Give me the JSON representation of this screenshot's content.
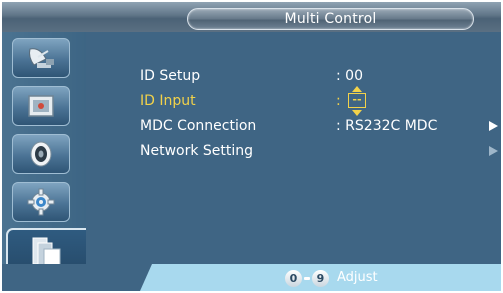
{
  "window": {
    "title": "Multi Control"
  },
  "sidebar": {
    "items": [
      {
        "icon": "satellite-dish-icon"
      },
      {
        "icon": "picture-frame-icon"
      },
      {
        "icon": "speaker-icon"
      },
      {
        "icon": "settings-gear-icon"
      },
      {
        "icon": "multi-display-icon",
        "active": true
      }
    ]
  },
  "menu": {
    "rows": [
      {
        "label": "ID Setup",
        "value": ": 00"
      },
      {
        "label": "ID Input",
        "value_prefix": ":",
        "value_box": "--",
        "selected": true
      },
      {
        "label": "MDC Connection",
        "value": ": RS232C MDC",
        "arrow": true
      },
      {
        "label": "Network Setting",
        "arrow": true,
        "arrow_dim": true
      }
    ]
  },
  "footer": {
    "key_start": "0",
    "key_end": "9",
    "action_label": "Adjust"
  },
  "colors": {
    "background": "#3f6584",
    "selected_text": "#f2d24a",
    "footer_bar": "#a8d9ee"
  }
}
